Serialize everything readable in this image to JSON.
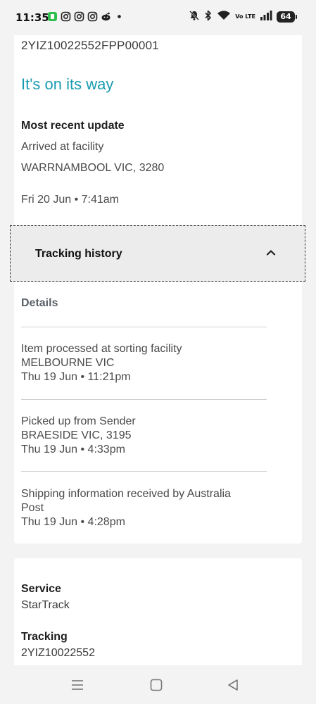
{
  "status_bar": {
    "time": "11:35",
    "left_icons": [
      "app-icon",
      "instagram-icon",
      "instagram-icon",
      "instagram-icon",
      "reddit-icon",
      "dot-icon"
    ],
    "volte": "Vo LTE",
    "battery": "64"
  },
  "shipment": {
    "tracking_id": "2YIZ10022552FPP00001",
    "status_heading": "It's on its way",
    "recent_title": "Most recent update",
    "recent_status": "Arrived at facility",
    "recent_location": "WARRNAMBOOL VIC, 3280",
    "recent_time": "Fri 20 Jun • 7:41am"
  },
  "history": {
    "title": "Tracking history",
    "details_label": "Details",
    "events": [
      {
        "line1": "Item processed at sorting facility",
        "line2": "MELBOURNE VIC",
        "line3": "Thu 19 Jun • 11:21pm"
      },
      {
        "line1": "Picked up from Sender",
        "line2": "BRAESIDE VIC, 3195",
        "line3": "Thu 19 Jun • 4:33pm"
      },
      {
        "line1": "Shipping information received by Australia",
        "line2": "Post",
        "line3": "Thu 19 Jun • 4:28pm"
      }
    ]
  },
  "service": {
    "service_label": "Service",
    "service_value": "StarTrack",
    "tracking_label": "Tracking",
    "tracking_value": "2YIZ10022552"
  },
  "colors": {
    "accent": "#1a9bb0",
    "background": "#f3f3f3",
    "card": "#ffffff"
  }
}
